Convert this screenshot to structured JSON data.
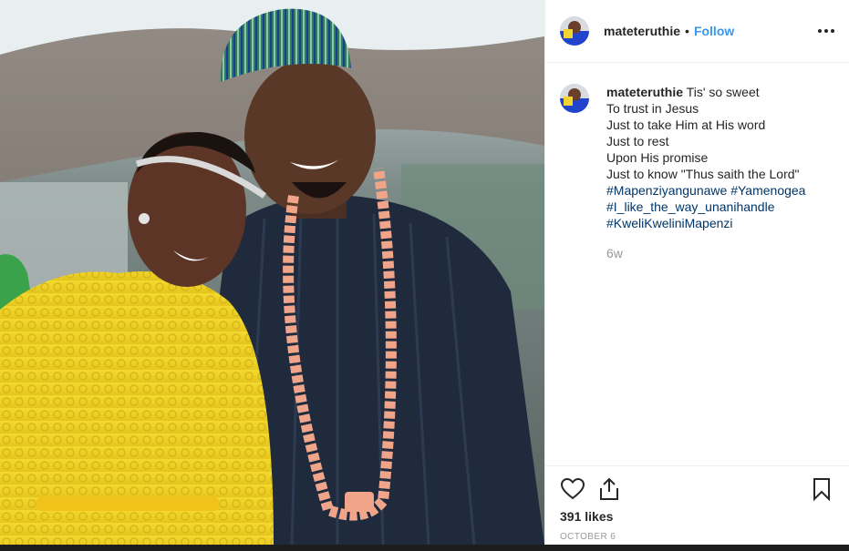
{
  "header": {
    "username": "mateteruthie",
    "separator": "•",
    "follow_label": "Follow",
    "more_icon": "more-horizontal-icon"
  },
  "caption": {
    "username": "mateteruthie",
    "first_line": "Tis' so sweet",
    "lines": [
      "To trust in Jesus",
      "Just to take Him at His word",
      "Just to rest",
      "Upon His promise",
      "Just to know \"Thus saith the Lord\""
    ],
    "hashtags_line1": [
      "#Mapenziyangunawe",
      "#Yamenogea"
    ],
    "hashtags_line2": [
      "#I_like_the_way_unanihandle"
    ],
    "hashtags_line3": [
      "#KweliKweliniMapenzi"
    ],
    "time_ago": "6w"
  },
  "actions": {
    "like_icon": "heart-icon",
    "share_icon": "share-icon",
    "save_icon": "bookmark-icon",
    "likes": "391 likes",
    "date": "OCTOBER 6"
  },
  "colors": {
    "link_blue": "#3897f0",
    "hashtag": "#003569",
    "muted": "#999999",
    "text": "#262626"
  }
}
